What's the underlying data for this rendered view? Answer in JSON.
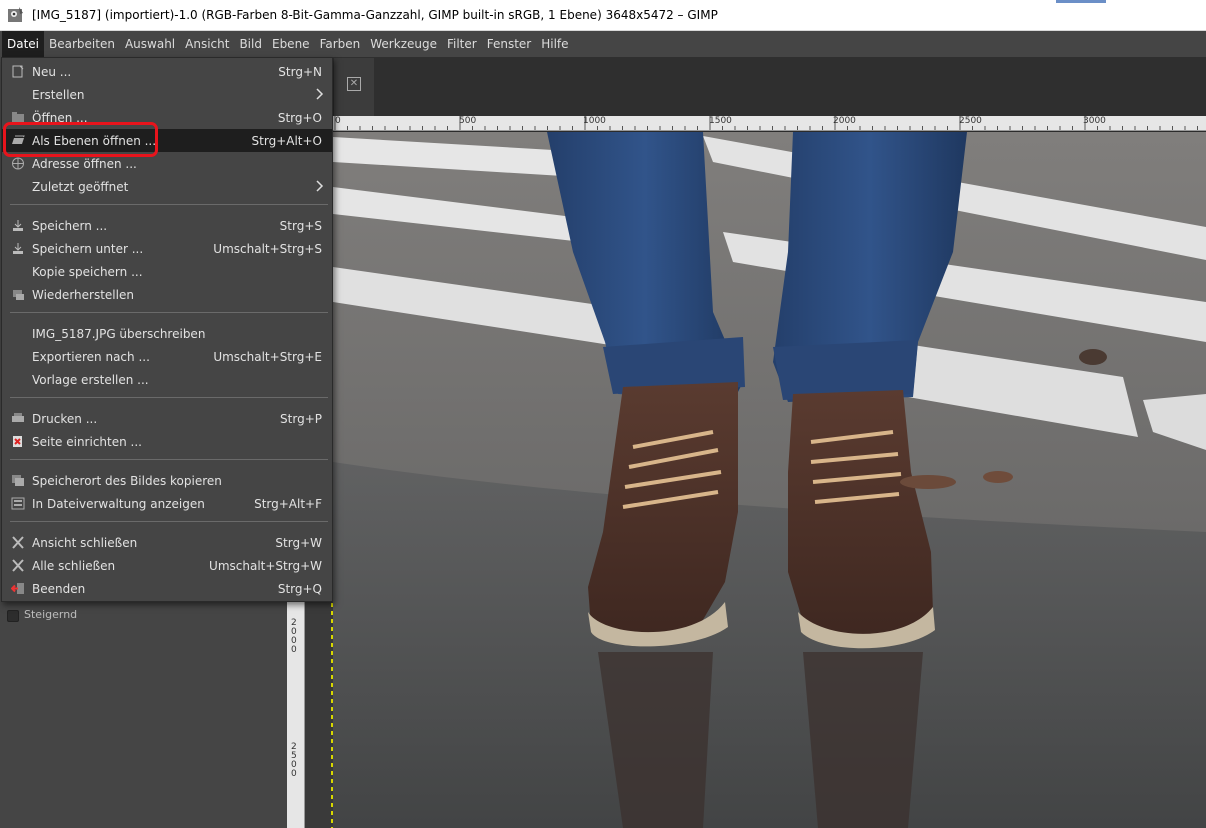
{
  "window": {
    "title": "[IMG_5187] (importiert)-1.0 (RGB-Farben 8-Bit-Gamma-Ganzzahl, GIMP built-in sRGB, 1 Ebene) 3648x5472 – GIMP"
  },
  "menubar": [
    "Datei",
    "Bearbeiten",
    "Auswahl",
    "Ansicht",
    "Bild",
    "Ebene",
    "Farben",
    "Werkzeuge",
    "Filter",
    "Fenster",
    "Hilfe"
  ],
  "file_menu": {
    "items": [
      {
        "label": "Neu ...",
        "shortcut": "Strg+N",
        "icon": "new-file-icon"
      },
      {
        "label": "Erstellen",
        "shortcut": "",
        "icon": "",
        "submenu": true
      },
      {
        "label": "Öffnen ...",
        "shortcut": "Strg+O",
        "icon": "open-file-icon"
      },
      {
        "label": "Als Ebenen öffnen ...",
        "shortcut": "Strg+Alt+O",
        "icon": "open-as-layers-icon",
        "highlighted": true
      },
      {
        "label": "Adresse öffnen ...",
        "shortcut": "",
        "icon": "globe-icon"
      },
      {
        "label": "Zuletzt geöffnet",
        "shortcut": "",
        "icon": "",
        "submenu": true
      },
      {
        "label": "Speichern ...",
        "shortcut": "Strg+S",
        "icon": "save-icon"
      },
      {
        "label": "Speichern unter ...",
        "shortcut": "Umschalt+Strg+S",
        "icon": "save-as-icon"
      },
      {
        "label": "Kopie speichern ...",
        "shortcut": "",
        "icon": ""
      },
      {
        "label": "Wiederherstellen",
        "shortcut": "",
        "icon": "revert-icon"
      },
      {
        "label": "IMG_5187.JPG überschreiben",
        "shortcut": "",
        "icon": ""
      },
      {
        "label": "Exportieren nach ...",
        "shortcut": "Umschalt+Strg+E",
        "icon": ""
      },
      {
        "label": "Vorlage erstellen ...",
        "shortcut": "",
        "icon": ""
      },
      {
        "label": "Drucken ...",
        "shortcut": "Strg+P",
        "icon": "printer-icon"
      },
      {
        "label": "Seite einrichten ...",
        "shortcut": "",
        "icon": "page-setup-icon"
      },
      {
        "label": "Speicherort des Bildes kopieren",
        "shortcut": "",
        "icon": "copy-location-icon"
      },
      {
        "label": "In Dateiverwaltung anzeigen",
        "shortcut": "Strg+Alt+F",
        "icon": "file-manager-icon"
      },
      {
        "label": "Ansicht schließen",
        "shortcut": "Strg+W",
        "icon": "close-icon"
      },
      {
        "label": "Alle schließen",
        "shortcut": "Umschalt+Strg+W",
        "icon": "close-all-icon"
      },
      {
        "label": "Beenden",
        "shortcut": "Strg+Q",
        "icon": "quit-icon"
      }
    ]
  },
  "left_dock": {
    "checkbox_label": "Steigernd"
  },
  "ruler": {
    "h_labels": [
      "0",
      "500",
      "1000",
      "1500",
      "2000",
      "2500",
      "3000"
    ],
    "v_labels": [
      "2000",
      "2500"
    ]
  },
  "colors": {
    "menu_bg": "#454545",
    "menu_highlight": "#1e1e1e",
    "annotation_red": "#e8141c"
  }
}
